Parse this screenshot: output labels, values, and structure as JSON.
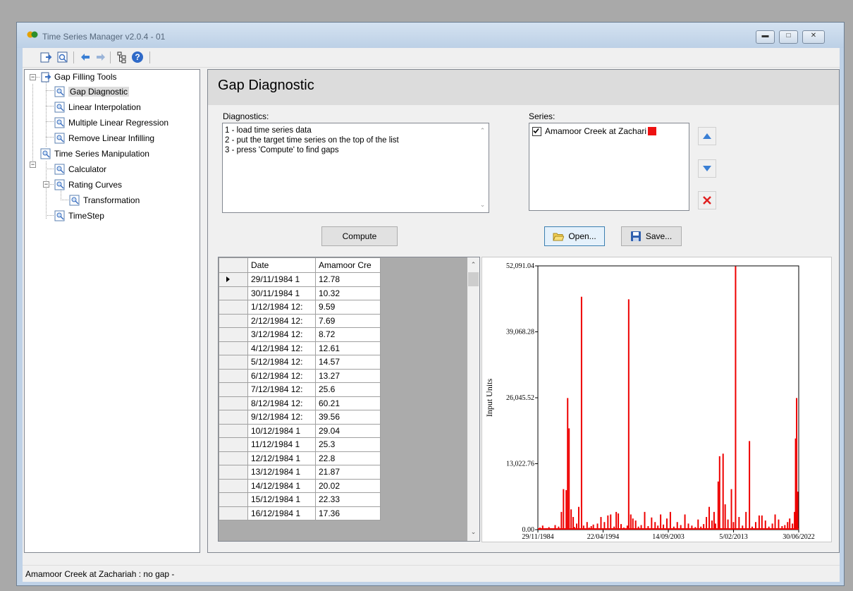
{
  "window": {
    "title": "Time Series Manager v2.0.4 - 01"
  },
  "toolbar": {
    "icons": [
      "open-icon",
      "search-icon",
      "back-arrow-icon",
      "forward-arrow-icon",
      "tree-icon",
      "help-icon"
    ]
  },
  "tree": {
    "items": [
      {
        "label": "Gap Filling Tools"
      },
      {
        "label": "Gap Diagnostic"
      },
      {
        "label": "Linear Interpolation"
      },
      {
        "label": "Multiple Linear Regression"
      },
      {
        "label": "Remove Linear Infilling"
      },
      {
        "label": "Time Series Manipulation"
      },
      {
        "label": "Calculator"
      },
      {
        "label": "Rating Curves"
      },
      {
        "label": "Transformation"
      },
      {
        "label": "TimeStep"
      }
    ]
  },
  "panel": {
    "title": "Gap Diagnostic",
    "diagnostics_label": "Diagnostics:",
    "diagnostics_lines": [
      "1 - load time series data",
      "2 - put the target time series on the top of the list",
      "3 - press 'Compute' to find gaps"
    ],
    "series_label": "Series:",
    "series_item": "Amamoor Creek at Zachari",
    "series_color": "#ee1111",
    "compute_label": "Compute",
    "open_label": "Open...",
    "save_label": "Save..."
  },
  "grid": {
    "columns": [
      "Date",
      "Amamoor Cre"
    ],
    "rows": [
      [
        "29/11/1984 1",
        "12.78"
      ],
      [
        "30/11/1984 1",
        "10.32"
      ],
      [
        "1/12/1984 12:",
        "9.59"
      ],
      [
        "2/12/1984 12:",
        "7.69"
      ],
      [
        "3/12/1984 12:",
        "8.72"
      ],
      [
        "4/12/1984 12:",
        "12.61"
      ],
      [
        "5/12/1984 12:",
        "14.57"
      ],
      [
        "6/12/1984 12:",
        "13.27"
      ],
      [
        "7/12/1984 12:",
        "25.6"
      ],
      [
        "8/12/1984 12:",
        "60.21"
      ],
      [
        "9/12/1984 12:",
        "39.56"
      ],
      [
        "10/12/1984 1",
        "29.04"
      ],
      [
        "11/12/1984 1",
        "25.3"
      ],
      [
        "12/12/1984 1",
        "22.8"
      ],
      [
        "13/12/1984 1",
        "21.87"
      ],
      [
        "14/12/1984 1",
        "20.02"
      ],
      [
        "15/12/1984 1",
        "22.33"
      ],
      [
        "16/12/1984 1",
        "17.36"
      ]
    ]
  },
  "chart_data": {
    "type": "bar",
    "ylabel": "Input Units",
    "ylim": [
      0,
      52091.04
    ],
    "yticks": [
      "0.00",
      "13,022.76",
      "26,045.52",
      "39,068.28",
      "52,091.04"
    ],
    "xticks": [
      "29/11/1984",
      "22/04/1994",
      "14/09/2003",
      "5/02/2013",
      "30/06/2022"
    ],
    "xlim_years": [
      1984.91,
      2022.5
    ],
    "grid": false,
    "color": "#ee0000",
    "series": [
      {
        "x": [
          1985.2,
          1985.6,
          1986.1,
          1986.5,
          1987.0,
          1987.4,
          1987.9,
          1988.3,
          1988.6,
          1989.0,
          1989.2,
          1989.4,
          1989.7,
          1990.0,
          1990.2,
          1990.5,
          1990.8,
          1991.2,
          1991.5,
          1992.0,
          1992.3,
          1992.6,
          1992.9,
          1993.5,
          1994.0,
          1994.5,
          1995.0,
          1995.4,
          1995.9,
          1996.2,
          1996.5,
          1996.9,
          1997.3,
          1997.8,
          1998.0,
          1998.3,
          1998.6,
          1999.0,
          1999.4,
          1999.8,
          2000.3,
          2000.8,
          2001.3,
          2001.8,
          2002.2,
          2002.6,
          2003.0,
          2003.5,
          2004.0,
          2004.5,
          2005.0,
          2005.5,
          2006.1,
          2006.6,
          2007.1,
          2007.6,
          2008.0,
          2008.4,
          2008.8,
          2009.2,
          2009.6,
          2010.0,
          2010.3,
          2010.5,
          2010.9,
          2011.1,
          2011.6,
          2011.9,
          2012.3,
          2012.8,
          2013.1,
          2013.4,
          2013.9,
          2014.4,
          2014.9,
          2015.4,
          2015.8,
          2016.3,
          2016.8,
          2017.2,
          2017.7,
          2018.2,
          2018.7,
          2019.1,
          2019.6,
          2020.1,
          2020.5,
          2020.9,
          2021.2,
          2021.6,
          2021.9,
          2022.05,
          2022.2,
          2022.35
        ],
        "y": [
          400,
          800,
          300,
          500,
          250,
          900,
          600,
          3500,
          8000,
          7800,
          26000,
          20000,
          4000,
          2500,
          500,
          1200,
          4500,
          46000,
          800,
          1500,
          400,
          700,
          1000,
          1200,
          2500,
          1500,
          2800,
          3000,
          600,
          3500,
          3200,
          1100,
          400,
          800,
          45500,
          3000,
          2200,
          1800,
          600,
          900,
          3500,
          700,
          2400,
          1500,
          800,
          3000,
          1000,
          2200,
          3500,
          600,
          1500,
          900,
          3000,
          1200,
          800,
          500,
          2000,
          600,
          1100,
          2500,
          4500,
          1800,
          3500,
          1200,
          9500,
          14500,
          15000,
          5000,
          2000,
          8000,
          1500,
          52000,
          2500,
          800,
          3500,
          17500,
          600,
          1500,
          2800,
          2800,
          1800,
          600,
          1200,
          3000,
          2000,
          700,
          900,
          1500,
          2200,
          1200,
          3500,
          18000,
          26000,
          7500
        ]
      }
    ]
  },
  "status": {
    "text": "Amamoor Creek at Zachariah : no gap -"
  }
}
